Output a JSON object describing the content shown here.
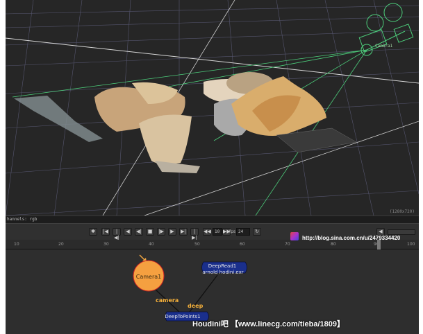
{
  "viewport": {
    "camera_label": "Camera1",
    "resolution": "(1280x720)"
  },
  "channel_bar": {
    "label": "hannels: rgb"
  },
  "transport": {
    "frame": "10",
    "fps_label": "fps",
    "fps": "24",
    "buttons": [
      "✱",
      "|◀",
      "|◀|",
      "◀",
      "◀|",
      "■",
      "|▶",
      "▶",
      "▶|",
      "|▶|",
      "▶|"
    ]
  },
  "timeline": {
    "ticks": [
      "10",
      "20",
      "30",
      "40",
      "50",
      "60",
      "70",
      "80",
      "90",
      "100"
    ]
  },
  "node_graph": {
    "camera_node": "Camera1",
    "deepread_title": "DeepRead1",
    "deepread_file": "arnold hodini.exr",
    "deeptopoints": "DeepToPoints1",
    "pipe_camera": "camera",
    "pipe_deep": "deep"
  },
  "overlays": {
    "blog_url": "http://blog.sina.com.cn/u/2479334420",
    "footer": "Houdini吧 【www.linecg.com/tieba/1809】"
  },
  "colors": {
    "grid": "#5e5e7a",
    "frustum": "#4dcf7c",
    "camera_node": "#f5a040",
    "deep_node": "#1a2f8c",
    "pipe_label": "#f5b03a"
  }
}
